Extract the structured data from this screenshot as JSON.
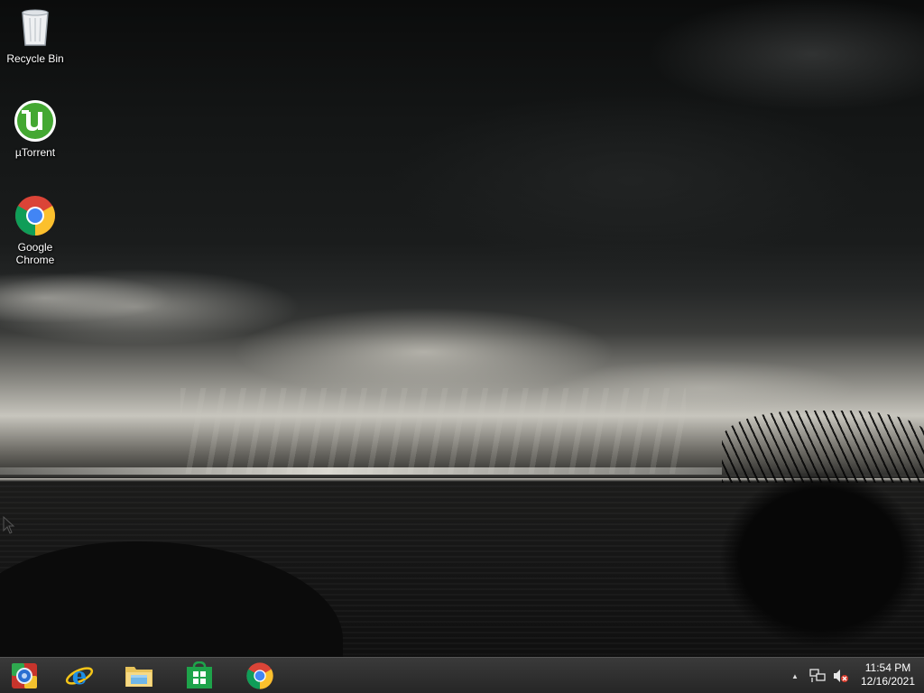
{
  "desktop": {
    "icons": [
      {
        "label": "Recycle Bin",
        "icon": "recycle-bin-icon"
      },
      {
        "label": "µTorrent",
        "icon": "utorrent-icon"
      },
      {
        "label": "Google Chrome",
        "icon": "chrome-icon"
      }
    ]
  },
  "taskbar": {
    "pinned": [
      {
        "icon": "remote-desktop-icon"
      },
      {
        "icon": "internet-explorer-icon"
      },
      {
        "icon": "file-explorer-icon"
      },
      {
        "icon": "windows-store-icon"
      },
      {
        "icon": "chrome-icon"
      }
    ],
    "tray": {
      "overflow_glyph": "▲",
      "network_icon": "network-icon",
      "volume_icon": "volume-muted-icon"
    },
    "clock": {
      "time": "11:54 PM",
      "date": "12/16/2021"
    }
  },
  "colors": {
    "taskbar": "#2b2b2b",
    "utorrent_green": "#44a832",
    "store_green": "#1ea34a"
  }
}
